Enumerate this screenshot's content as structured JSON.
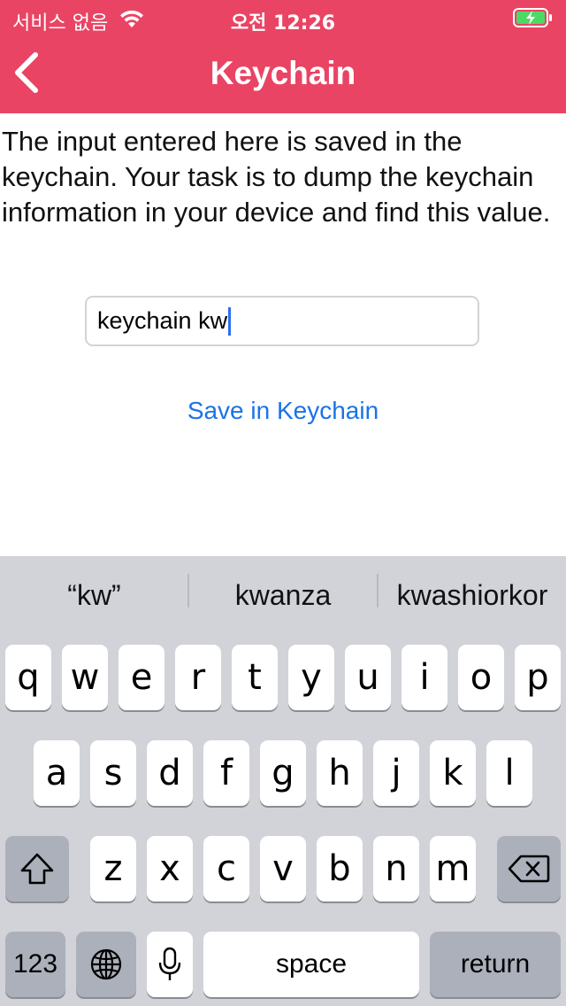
{
  "status_bar": {
    "carrier": "서비스 없음",
    "time": "오전 12:26"
  },
  "nav": {
    "title": "Keychain"
  },
  "instructions": "The input entered here is saved in the keychain. Your task is to dump the keychain information in your device and find this value.",
  "input": {
    "value": "keychain kw"
  },
  "save_button_label": "Save in Keychain",
  "keyboard": {
    "suggestions": [
      "“kw”",
      "kwanza",
      "kwashiorkor"
    ],
    "row1": [
      "q",
      "w",
      "e",
      "r",
      "t",
      "y",
      "u",
      "i",
      "o",
      "p"
    ],
    "row2": [
      "a",
      "s",
      "d",
      "f",
      "g",
      "h",
      "j",
      "k",
      "l"
    ],
    "row3": [
      "z",
      "x",
      "c",
      "v",
      "b",
      "n",
      "m"
    ],
    "numbers_label": "123",
    "space_label": "space",
    "return_label": "return"
  },
  "colors": {
    "header_bg": "#ea4464",
    "link": "#1a73e8",
    "keyboard_bg": "#d1d3d9",
    "caret": "#2c6ef2"
  }
}
